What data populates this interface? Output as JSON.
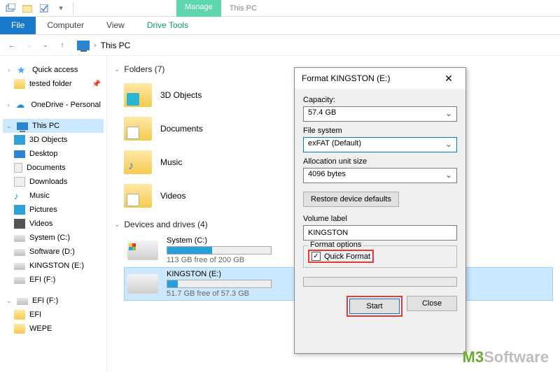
{
  "titlebar": {
    "ctx_tab": "Manage",
    "window_title": "This PC"
  },
  "ribbon": {
    "file": "File",
    "tabs": [
      "Computer",
      "View"
    ],
    "ctx_tab": "Drive Tools"
  },
  "addressbar": {
    "location": "This PC"
  },
  "nav": {
    "quick_access": "Quick access",
    "tested_folder": "tested folder",
    "onedrive": "OneDrive - Personal",
    "this_pc": "This PC",
    "items": {
      "objects3d": "3D Objects",
      "desktop": "Desktop",
      "documents": "Documents",
      "downloads": "Downloads",
      "music": "Music",
      "pictures": "Pictures",
      "videos": "Videos",
      "system": "System (C:)",
      "software": "Software (D:)",
      "kingston": "KINGSTON (E:)",
      "efi": "EFI (F:)"
    },
    "efi_drive": "EFI (F:)",
    "efi_sub1": "EFI",
    "efi_sub2": "WEPE"
  },
  "content": {
    "folders_hdr": "Folders (7)",
    "folders": {
      "objects3d": "3D Objects",
      "documents": "Documents",
      "music": "Music",
      "videos": "Videos"
    },
    "drives_hdr": "Devices and drives (4)",
    "system": {
      "name": "System (C:)",
      "free": "113 GB free of 200 GB",
      "fill_pct": 43
    },
    "kingston": {
      "name": "KINGSTON (E:)",
      "free": "51.7 GB free of 57.3 GB",
      "fill_pct": 10
    }
  },
  "dialog": {
    "title": "Format KINGSTON (E:)",
    "capacity_label": "Capacity:",
    "capacity_value": "57.4 GB",
    "fs_label": "File system",
    "fs_value": "exFAT (Default)",
    "alloc_label": "Allocation unit size",
    "alloc_value": "4096 bytes",
    "restore_btn": "Restore device defaults",
    "volume_label": "Volume label",
    "volume_value": "KINGSTON",
    "format_options": "Format options",
    "quick_format": "Quick Format",
    "start": "Start",
    "close": "Close"
  },
  "watermark": {
    "m3": "M3",
    "soft": "Software"
  }
}
